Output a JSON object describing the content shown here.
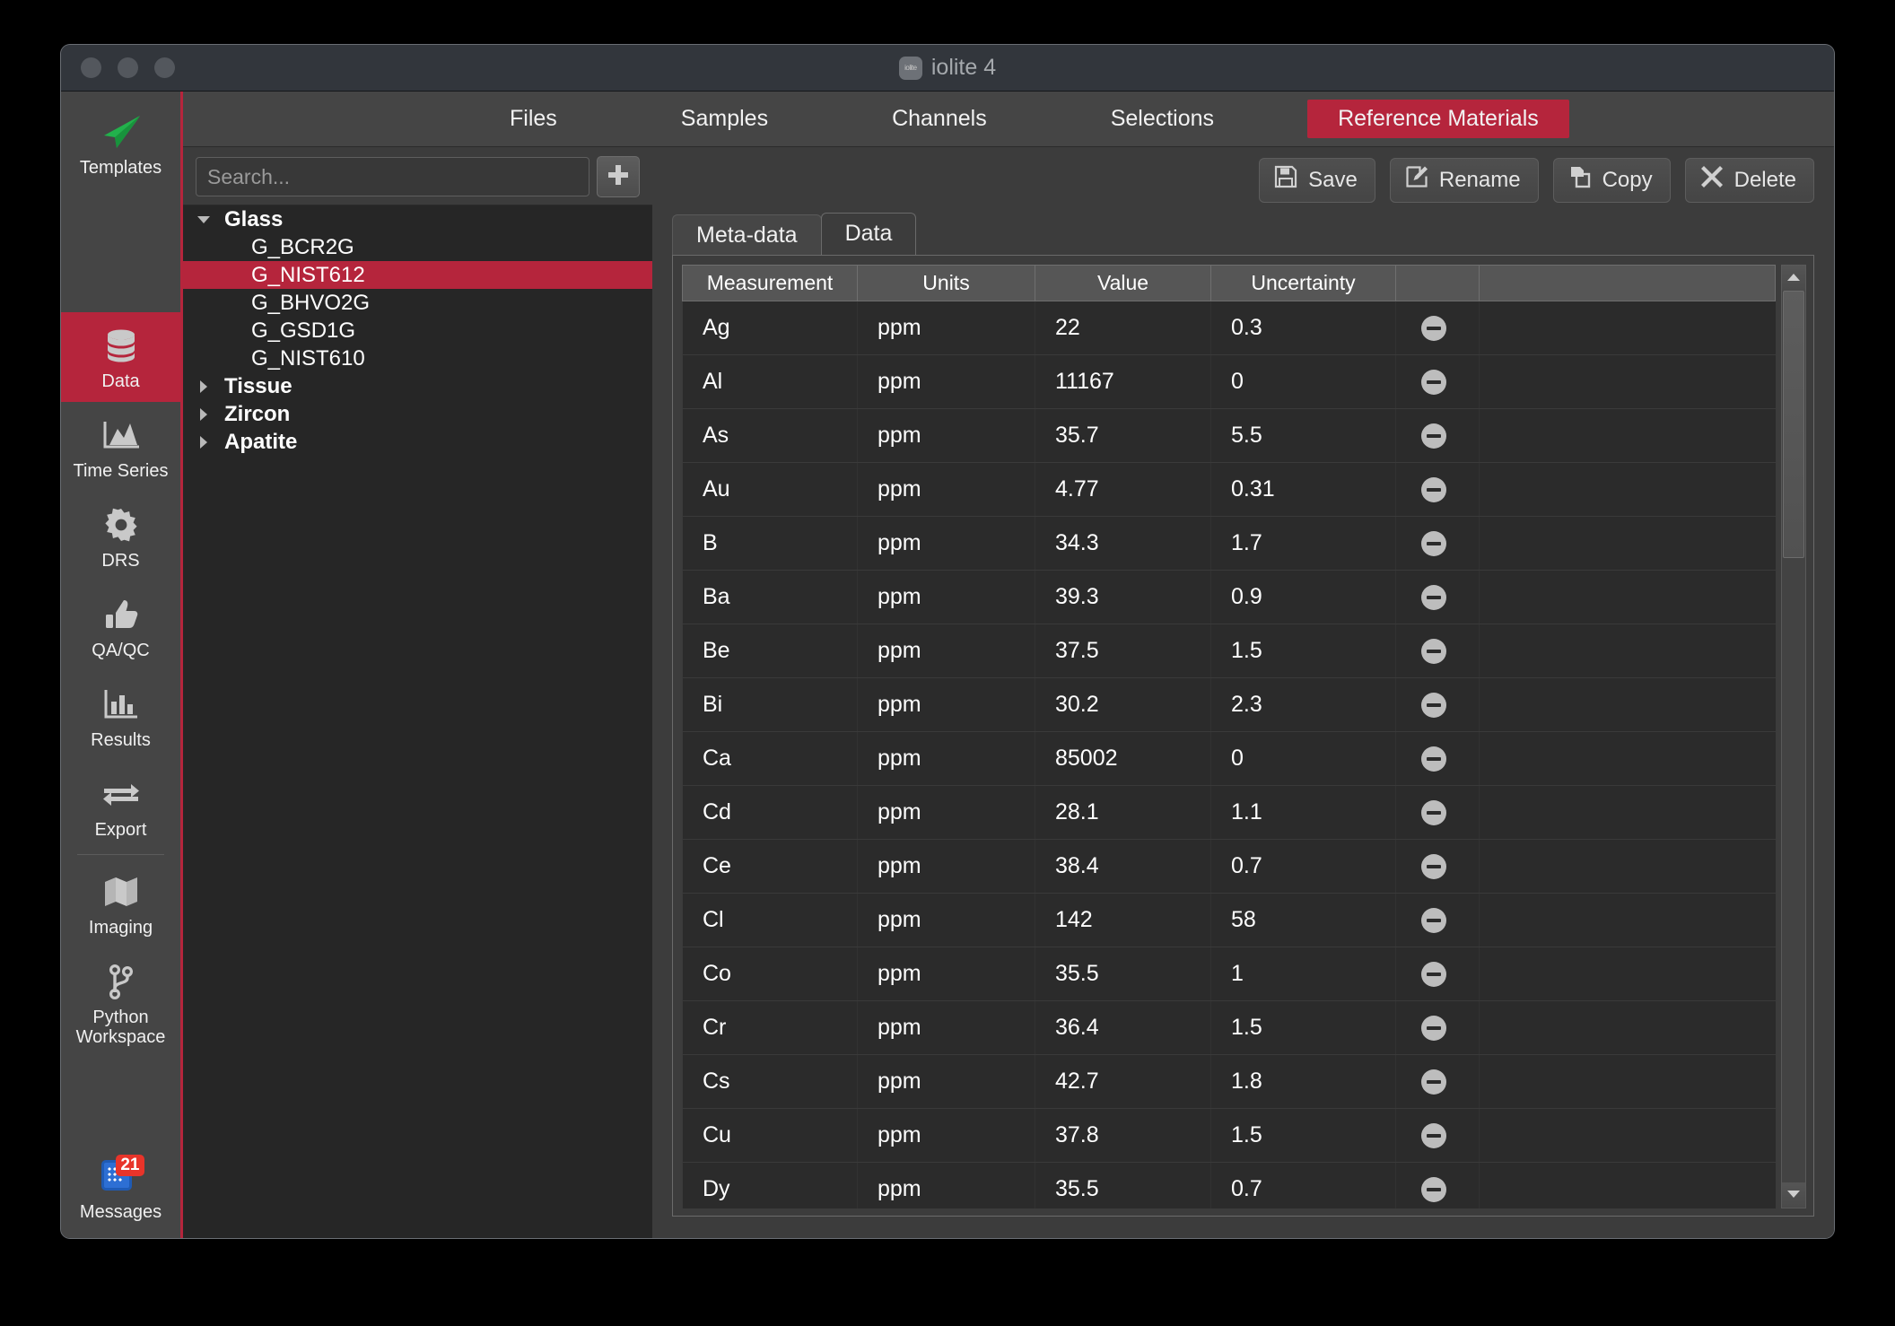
{
  "window": {
    "title": "iolite 4",
    "app_icon": "iolite-app-icon",
    "traffic_lights": [
      "close",
      "minimize",
      "zoom"
    ]
  },
  "sidebar": {
    "items": [
      {
        "label": "Templates",
        "icon": "paper-plane-icon",
        "active": false
      },
      {
        "label": "Data",
        "icon": "database-icon",
        "active": true
      },
      {
        "label": "Time Series",
        "icon": "area-chart-icon",
        "active": false
      },
      {
        "label": "DRS",
        "icon": "gear-icon",
        "active": false
      },
      {
        "label": "QA/QC",
        "icon": "thumbs-up-icon",
        "active": false
      },
      {
        "label": "Results",
        "icon": "bar-chart-icon",
        "active": false
      },
      {
        "label": "Export",
        "icon": "exchange-arrows-icon",
        "active": false
      },
      {
        "label": "Imaging",
        "icon": "map-icon",
        "active": false
      },
      {
        "label": "Python Workspace",
        "icon": "git-branch-icon",
        "active": false
      }
    ],
    "messages": {
      "label": "Messages",
      "icon": "messages-icon",
      "badge": "21"
    }
  },
  "top_tabs": [
    {
      "label": "Files",
      "active": false
    },
    {
      "label": "Samples",
      "active": false
    },
    {
      "label": "Channels",
      "active": false
    },
    {
      "label": "Selections",
      "active": false
    },
    {
      "label": "Reference Materials",
      "active": true
    }
  ],
  "search": {
    "placeholder": "Search...",
    "value": "",
    "add_button": "plus-icon"
  },
  "tree": [
    {
      "label": "Glass",
      "level": 0,
      "expanded": true,
      "selected": false
    },
    {
      "label": "G_BCR2G",
      "level": 1,
      "expanded": null,
      "selected": false
    },
    {
      "label": "G_NIST612",
      "level": 1,
      "expanded": null,
      "selected": true
    },
    {
      "label": "G_BHVO2G",
      "level": 1,
      "expanded": null,
      "selected": false
    },
    {
      "label": "G_GSD1G",
      "level": 1,
      "expanded": null,
      "selected": false
    },
    {
      "label": "G_NIST610",
      "level": 1,
      "expanded": null,
      "selected": false
    },
    {
      "label": "Tissue",
      "level": 0,
      "expanded": false,
      "selected": false
    },
    {
      "label": "Zircon",
      "level": 0,
      "expanded": false,
      "selected": false
    },
    {
      "label": "Apatite",
      "level": 0,
      "expanded": false,
      "selected": false
    }
  ],
  "toolbar": [
    {
      "label": "Save",
      "icon": "floppy-disk-icon"
    },
    {
      "label": "Rename",
      "icon": "pencil-edit-icon"
    },
    {
      "label": "Copy",
      "icon": "copy-pages-icon"
    },
    {
      "label": "Delete",
      "icon": "x-cross-icon"
    }
  ],
  "detail_tabs": [
    {
      "label": "Meta-data",
      "active": false
    },
    {
      "label": "Data",
      "active": true
    }
  ],
  "table": {
    "columns": [
      "Measurement",
      "Units",
      "Value",
      "Uncertainty",
      ""
    ],
    "rows": [
      {
        "measurement": "Ag",
        "units": "ppm",
        "value": "22",
        "uncertainty": "0.3",
        "remove": "remove-icon"
      },
      {
        "measurement": "Al",
        "units": "ppm",
        "value": "11167",
        "uncertainty": "0",
        "remove": "remove-icon"
      },
      {
        "measurement": "As",
        "units": "ppm",
        "value": "35.7",
        "uncertainty": "5.5",
        "remove": "remove-icon"
      },
      {
        "measurement": "Au",
        "units": "ppm",
        "value": "4.77",
        "uncertainty": "0.31",
        "remove": "remove-icon"
      },
      {
        "measurement": "B",
        "units": "ppm",
        "value": "34.3",
        "uncertainty": "1.7",
        "remove": "remove-icon"
      },
      {
        "measurement": "Ba",
        "units": "ppm",
        "value": "39.3",
        "uncertainty": "0.9",
        "remove": "remove-icon"
      },
      {
        "measurement": "Be",
        "units": "ppm",
        "value": "37.5",
        "uncertainty": "1.5",
        "remove": "remove-icon"
      },
      {
        "measurement": "Bi",
        "units": "ppm",
        "value": "30.2",
        "uncertainty": "2.3",
        "remove": "remove-icon"
      },
      {
        "measurement": "Ca",
        "units": "ppm",
        "value": "85002",
        "uncertainty": "0",
        "remove": "remove-icon"
      },
      {
        "measurement": "Cd",
        "units": "ppm",
        "value": "28.1",
        "uncertainty": "1.1",
        "remove": "remove-icon"
      },
      {
        "measurement": "Ce",
        "units": "ppm",
        "value": "38.4",
        "uncertainty": "0.7",
        "remove": "remove-icon"
      },
      {
        "measurement": "Cl",
        "units": "ppm",
        "value": "142",
        "uncertainty": "58",
        "remove": "remove-icon"
      },
      {
        "measurement": "Co",
        "units": "ppm",
        "value": "35.5",
        "uncertainty": "1",
        "remove": "remove-icon"
      },
      {
        "measurement": "Cr",
        "units": "ppm",
        "value": "36.4",
        "uncertainty": "1.5",
        "remove": "remove-icon"
      },
      {
        "measurement": "Cs",
        "units": "ppm",
        "value": "42.7",
        "uncertainty": "1.8",
        "remove": "remove-icon"
      },
      {
        "measurement": "Cu",
        "units": "ppm",
        "value": "37.8",
        "uncertainty": "1.5",
        "remove": "remove-icon"
      },
      {
        "measurement": "Dy",
        "units": "ppm",
        "value": "35.5",
        "uncertainty": "0.7",
        "remove": "remove-icon"
      }
    ],
    "scrollbar": {
      "up": "triangle-up-icon",
      "down": "triangle-down-icon",
      "thumb_position_pct": 0
    }
  },
  "colors": {
    "accent_red": "#b5253c",
    "badge_red": "#e8342a",
    "templates_green": "#22b14c",
    "window_bg": "#3c3c3c",
    "rail_bg": "#454545",
    "tree_bg": "#262626",
    "table_row_bg": "#2b2b2b"
  }
}
